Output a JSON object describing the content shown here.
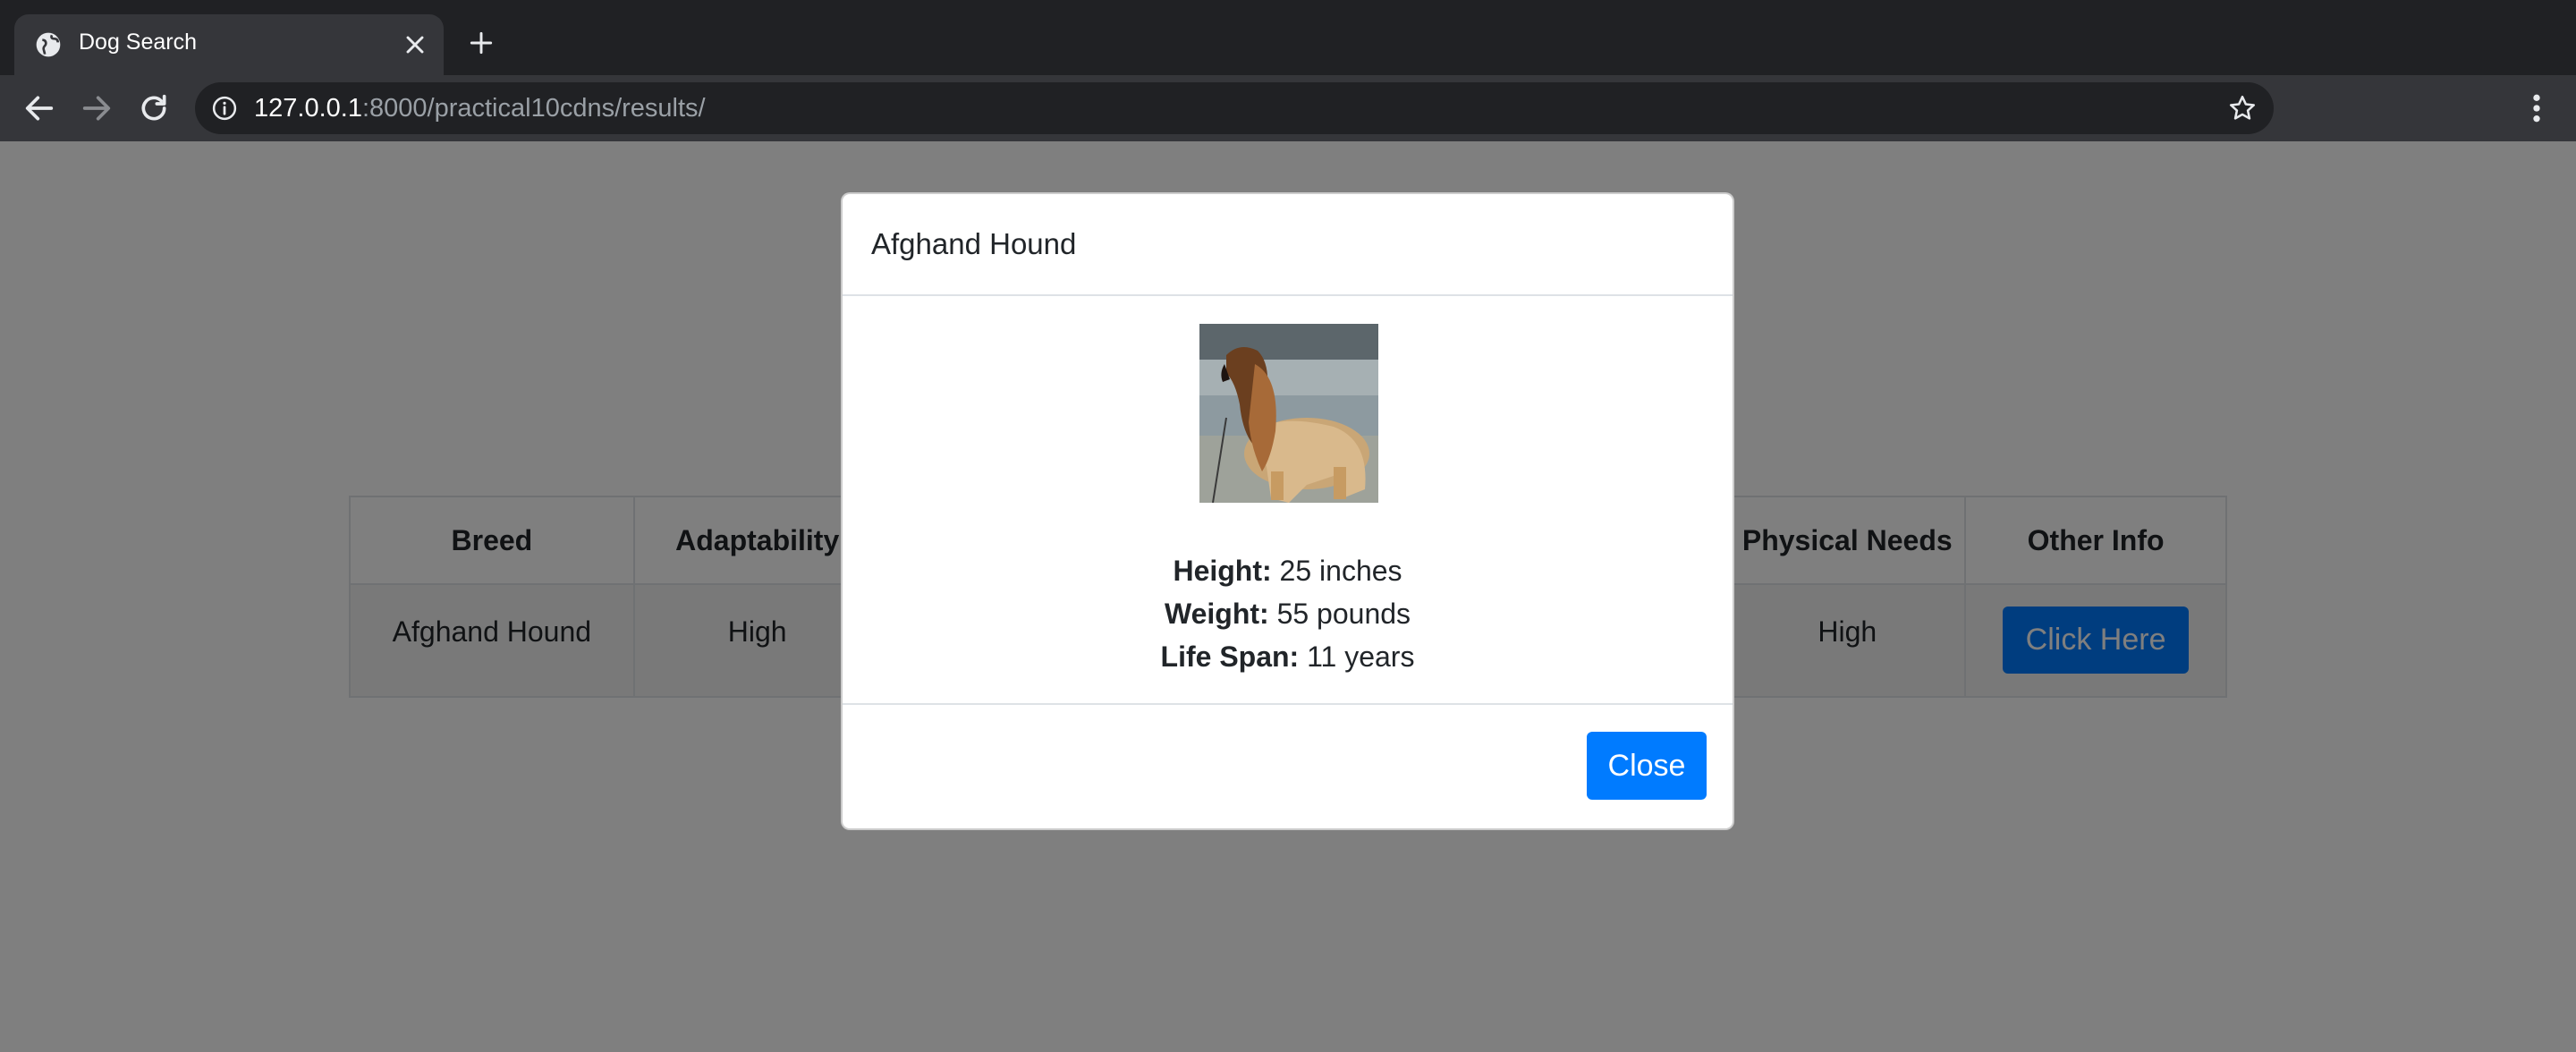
{
  "browser": {
    "tab_title": "Dog Search",
    "url_host": "127.0.0.1",
    "url_rest": ":8000/practical10cdns/results/",
    "icons": [
      "globe-icon",
      "close-icon",
      "plus-icon",
      "back-arrow-icon",
      "forward-arrow-icon",
      "reload-icon",
      "info-icon",
      "star-icon",
      "more-vert-icon"
    ]
  },
  "table": {
    "headers": [
      "Breed",
      "Adaptability",
      "",
      "",
      "Physical Needs",
      "Other Info"
    ],
    "row": {
      "breed": "Afghand Hound",
      "adaptability": "High",
      "physical_needs": "High",
      "button_label": "Click Here"
    }
  },
  "modal": {
    "title": "Afghand Hound",
    "height_label": "Height:",
    "height_value": " 25 inches",
    "weight_label": "Weight:",
    "weight_value": " 55 pounds",
    "lifespan_label": "Life Span:",
    "lifespan_value": " 11 years",
    "close_label": "Close"
  },
  "colors": {
    "accent": "#007bff",
    "chrome_dark": "#202124",
    "chrome_toolbar": "#35363a",
    "backdrop": "#808080"
  }
}
